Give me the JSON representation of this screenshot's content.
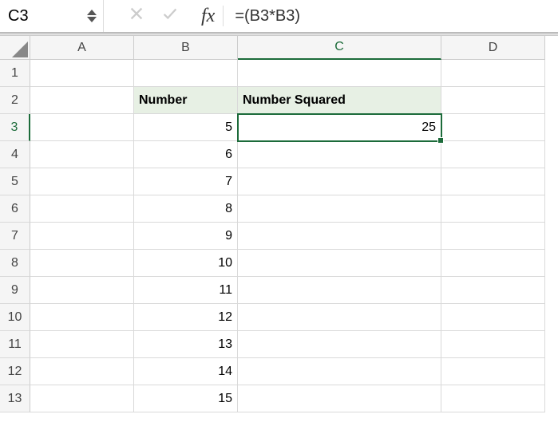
{
  "nameBox": "C3",
  "fxLabel": "fx",
  "formula": "=(B3*B3)",
  "columns": [
    "A",
    "B",
    "C",
    "D"
  ],
  "activeColumnIndex": 2,
  "activeRowIndex": 2,
  "rows": [
    {
      "n": "1",
      "A": "",
      "B": "",
      "C": "",
      "D": ""
    },
    {
      "n": "2",
      "A": "",
      "B": "Number",
      "C": "Number Squared",
      "D": "",
      "headerRow": true
    },
    {
      "n": "3",
      "A": "",
      "B": "5",
      "C": "25",
      "D": "",
      "selected": true
    },
    {
      "n": "4",
      "A": "",
      "B": "6",
      "C": "",
      "D": ""
    },
    {
      "n": "5",
      "A": "",
      "B": "7",
      "C": "",
      "D": ""
    },
    {
      "n": "6",
      "A": "",
      "B": "8",
      "C": "",
      "D": ""
    },
    {
      "n": "7",
      "A": "",
      "B": "9",
      "C": "",
      "D": ""
    },
    {
      "n": "8",
      "A": "",
      "B": "10",
      "C": "",
      "D": ""
    },
    {
      "n": "9",
      "A": "",
      "B": "11",
      "C": "",
      "D": ""
    },
    {
      "n": "10",
      "A": "",
      "B": "12",
      "C": "",
      "D": ""
    },
    {
      "n": "11",
      "A": "",
      "B": "13",
      "C": "",
      "D": ""
    },
    {
      "n": "12",
      "A": "",
      "B": "14",
      "C": "",
      "D": ""
    },
    {
      "n": "13",
      "A": "",
      "B": "15",
      "C": "",
      "D": ""
    }
  ]
}
